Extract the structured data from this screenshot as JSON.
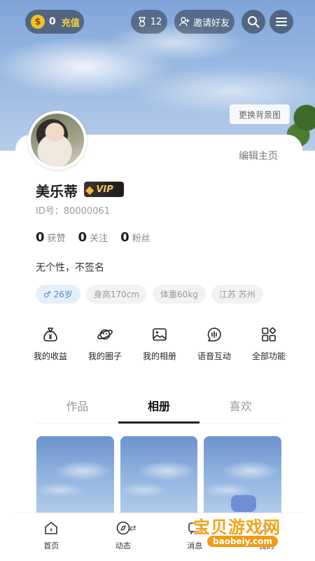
{
  "top_bar": {
    "coins": "0",
    "recharge_label": "充值",
    "badge_count": "12",
    "invite_label": "邀请好友"
  },
  "header": {
    "change_bg_label": "更换背景图"
  },
  "profile": {
    "edit_label": "编辑主页",
    "name": "美乐蒂",
    "vip_label": "VIP",
    "id_text": "ID号：80000061",
    "stats": [
      {
        "count": "0",
        "label": "获赞"
      },
      {
        "count": "0",
        "label": "关注"
      },
      {
        "count": "0",
        "label": "粉丝"
      }
    ],
    "signature": "无个性，不签名",
    "tags": [
      "♂ 26岁",
      "身高170cm",
      "体重60kg",
      "江苏 苏州"
    ]
  },
  "features": [
    {
      "label": "我的收益",
      "icon": "money-bag-icon"
    },
    {
      "label": "我的圈子",
      "icon": "planet-icon"
    },
    {
      "label": "我的相册",
      "icon": "image-icon"
    },
    {
      "label": "语音互动",
      "icon": "voice-chat-icon"
    },
    {
      "label": "全部功能",
      "icon": "grid-icon"
    }
  ],
  "tabs": [
    {
      "label": "作品",
      "active": false
    },
    {
      "label": "相册",
      "active": true
    },
    {
      "label": "喜欢",
      "active": false
    }
  ],
  "bottom_nav": [
    {
      "label": "首页",
      "icon": "home-icon"
    },
    {
      "label": "动态",
      "icon": "compass-icon"
    },
    {
      "label": "消息",
      "icon": "message-icon"
    },
    {
      "label": "我的",
      "icon": "user-icon"
    }
  ],
  "watermark": {
    "title": "宝贝游戏网",
    "url": "baobeiy.com"
  },
  "colors": {
    "accent_gold": "#f8d23a",
    "vip_gold": "#f3c667",
    "gender_blue": "#4a8ad8"
  }
}
